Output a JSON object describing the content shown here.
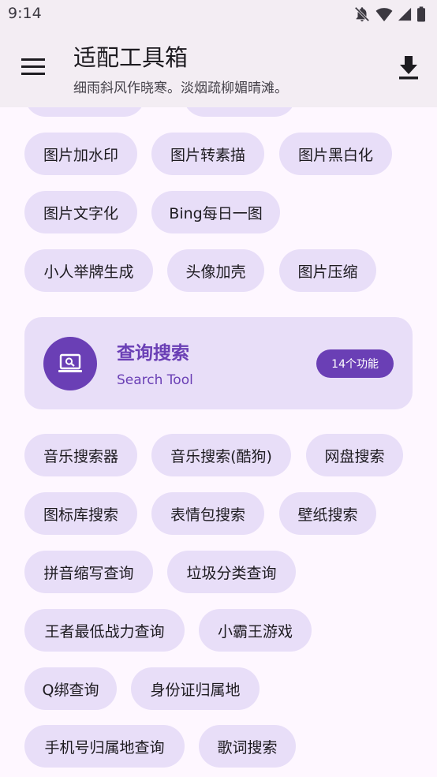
{
  "status_bar": {
    "time": "9:14",
    "icons": [
      "notifications-off-icon",
      "wifi-icon",
      "signal-icon",
      "battery-icon"
    ]
  },
  "app_bar": {
    "title": "适配工具箱",
    "subtitle": "细雨斜风作晓寒。淡烟疏柳媚晴滩。",
    "menu_icon": "menu-icon",
    "download_icon": "download-icon"
  },
  "image_tools": {
    "chips": [
      "图片加水印",
      "图片转素描",
      "图片黑白化",
      "图片文字化",
      "Bing每日一图",
      "小人举牌生成",
      "头像加壳",
      "图片压缩"
    ]
  },
  "search_category": {
    "title": "查询搜索",
    "subtitle": "Search Tool",
    "count": "14个功能",
    "icon": "laptop-search-icon",
    "chips": [
      "音乐搜索器",
      "音乐搜索(酷狗)",
      "网盘搜索",
      "图标库搜索",
      "表情包搜索",
      "壁纸搜索",
      "拼音缩写查询",
      "垃圾分类查询",
      "王者最低战力查询",
      "小霸王游戏",
      "Q绑查询",
      "身份证归属地",
      "手机号归属地查询",
      "歌词搜索"
    ]
  },
  "colors": {
    "background": "#FEF7FF",
    "app_bar": "#F3EDF3",
    "chip": "#E8DEF8",
    "accent": "#6A3FB5"
  }
}
